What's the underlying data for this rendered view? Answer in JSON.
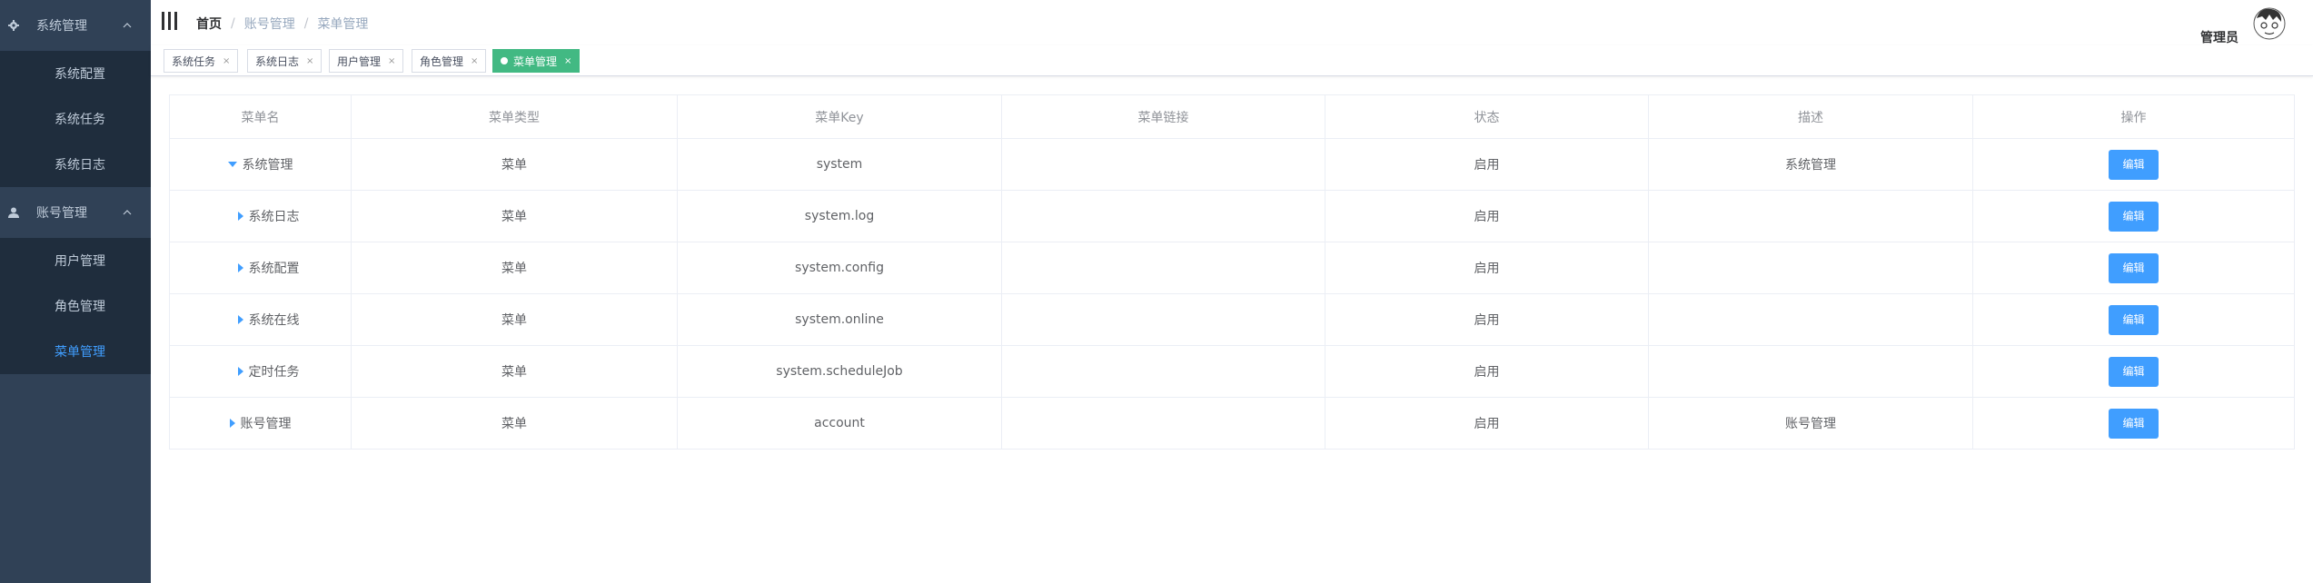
{
  "sidebar": {
    "groups": [
      {
        "label": "系统管理",
        "icon": "gear-icon",
        "items": [
          {
            "label": "系统配置",
            "active": false
          },
          {
            "label": "系统任务",
            "active": false
          },
          {
            "label": "系统日志",
            "active": false
          }
        ]
      },
      {
        "label": "账号管理",
        "icon": "user-icon",
        "items": [
          {
            "label": "用户管理",
            "active": false
          },
          {
            "label": "角色管理",
            "active": false
          },
          {
            "label": "菜单管理",
            "active": true
          }
        ]
      }
    ]
  },
  "header": {
    "breadcrumb": [
      "首页",
      "账号管理",
      "菜单管理"
    ],
    "breadcrumb_separator": "/",
    "user_name": "管理员"
  },
  "tags": [
    {
      "label": "系统任务",
      "active": false
    },
    {
      "label": "系统日志",
      "active": false
    },
    {
      "label": "用户管理",
      "active": false
    },
    {
      "label": "角色管理",
      "active": false
    },
    {
      "label": "菜单管理",
      "active": true
    }
  ],
  "tag_close": "×",
  "table": {
    "columns": [
      "菜单名",
      "菜单类型",
      "菜单Key",
      "菜单链接",
      "状态",
      "描述",
      "操作"
    ],
    "rows": [
      {
        "name": "系统管理",
        "type": "菜单",
        "key": "system",
        "link": "",
        "status": "启用",
        "desc": "系统管理",
        "action": "编辑",
        "expanded": true
      },
      {
        "name": "系统日志",
        "type": "菜单",
        "key": "system.log",
        "link": "",
        "status": "启用",
        "desc": "",
        "action": "编辑",
        "expanded": false
      },
      {
        "name": "系统配置",
        "type": "菜单",
        "key": "system.config",
        "link": "",
        "status": "启用",
        "desc": "",
        "action": "编辑",
        "expanded": false
      },
      {
        "name": "系统在线",
        "type": "菜单",
        "key": "system.online",
        "link": "",
        "status": "启用",
        "desc": "",
        "action": "编辑",
        "expanded": false
      },
      {
        "name": "定时任务",
        "type": "菜单",
        "key": "system.scheduleJob",
        "link": "",
        "status": "启用",
        "desc": "",
        "action": "编辑",
        "expanded": false
      },
      {
        "name": "账号管理",
        "type": "菜单",
        "key": "account",
        "link": "",
        "status": "启用",
        "desc": "账号管理",
        "action": "编辑",
        "expanded": false
      }
    ]
  },
  "colors": {
    "sidebar_bg": "#304156",
    "submenu_bg": "#1f2d3d",
    "active_menu": "#409eff",
    "active_tag": "#42b983",
    "button": "#409eff"
  }
}
